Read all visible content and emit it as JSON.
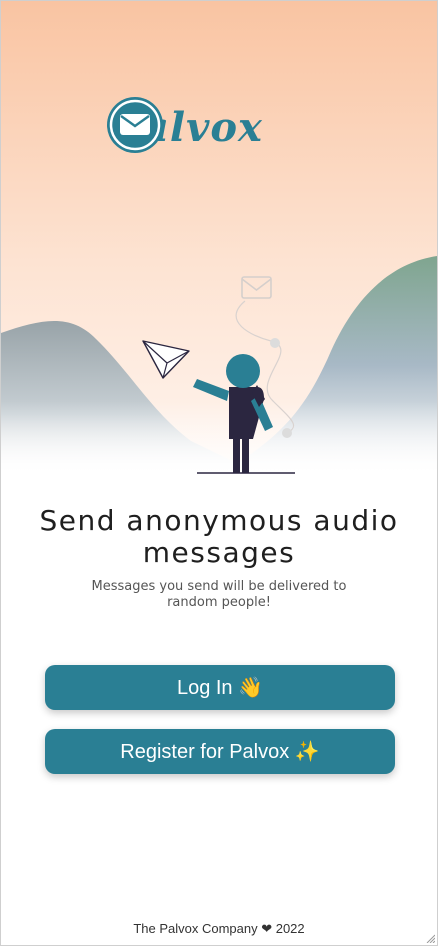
{
  "app": {
    "name": "Palvox"
  },
  "hero": {
    "illustration": "person-with-paper-plane"
  },
  "content": {
    "headline": "Send anonymous audio messages",
    "subtitle": "Messages you send will be delivered to random people!"
  },
  "actions": {
    "login_label": "Log In 👋",
    "register_label": "Register for Palvox ✨"
  },
  "footer": {
    "text": "The Palvox Company ❤ 2022"
  },
  "colors": {
    "accent": "#2a7f94",
    "sky_top": "#f9c9a9",
    "sky_bottom": "#fde7d8"
  },
  "icons": [
    "mail-icon",
    "paper-plane-icon",
    "envelope-icon"
  ]
}
